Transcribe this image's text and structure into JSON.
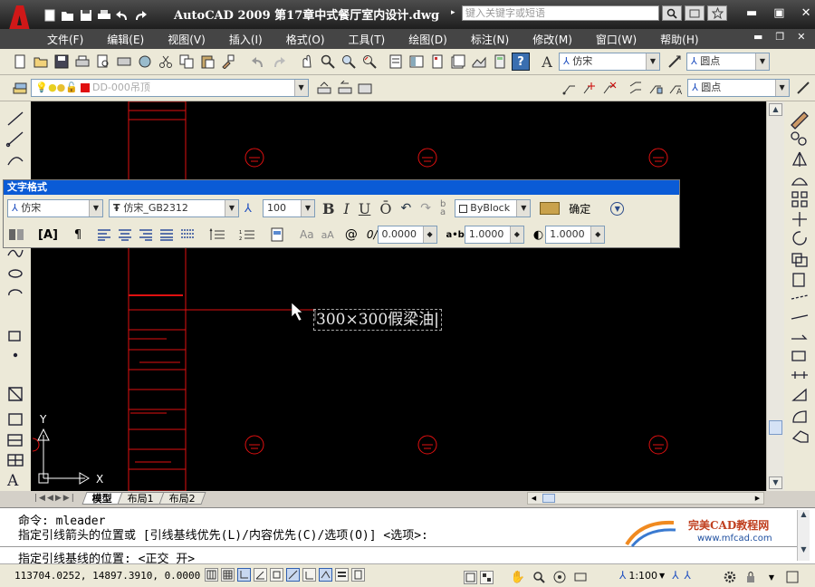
{
  "app": {
    "title": "AutoCAD 2009  第17章中式餐厅室内设计.dwg",
    "search_placeholder": "键入关键字或短语"
  },
  "menu": [
    "文件(F)",
    "编辑(E)",
    "视图(V)",
    "插入(I)",
    "格式(O)",
    "工具(T)",
    "绘图(D)",
    "标注(N)",
    "修改(M)",
    "窗口(W)",
    "帮助(H)"
  ],
  "toolbar": {
    "text_style": "仿宋",
    "dim_style": "圆点",
    "layer": "DD-000吊顶",
    "mleader_style": "圆点"
  },
  "text_format": {
    "title": "文字格式",
    "style": "仿宋",
    "font": "仿宋_GB2312",
    "height": "100",
    "bold_label": "B",
    "italic_label": "I",
    "underline_label": "U",
    "overline_label": "Ō",
    "color": "ByBlock",
    "ok_label": "确定",
    "oblique": "0.0000",
    "tracking": "1.0000",
    "width_factor": "1.0000",
    "oblique_prefix": "0/",
    "tracking_prefix": "a•b",
    "aa_big": "Aa",
    "aa_small": "aA",
    "at_label": "@"
  },
  "drawing": {
    "mtext": "300×300假梁油",
    "ucs_x": "X",
    "ucs_y": "Y"
  },
  "layout_tabs": [
    "模型",
    "布局1",
    "布局2"
  ],
  "command": {
    "line1": "命令:  mleader",
    "line2": "指定引线箭头的位置或 [引线基线优先(L)/内容优先(C)/选项(O)] <选项>:",
    "line3": "指定引线基线的位置: <正交 开>",
    "watermark_title": "完美CAD教程网",
    "watermark_url": "www.mfcad.com"
  },
  "status": {
    "coords": "113704.0252, 14897.3910, 0.0000",
    "scale": "1:100"
  },
  "colors": {
    "accent_red": "#e01010",
    "panel_title": "#0a5bd6"
  }
}
